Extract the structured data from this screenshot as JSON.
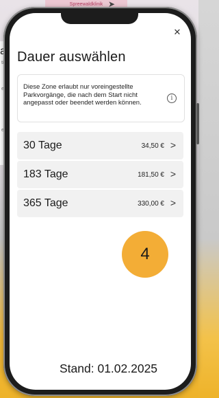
{
  "background": {
    "map_label": "Spreewaldklinik",
    "nav_icon": "navigation-arrow-icon",
    "left_fragments": [
      "a",
      "ti",
      "eit",
      "eit"
    ]
  },
  "sheet": {
    "close_icon": "close-icon",
    "title": "Dauer auswählen",
    "info": {
      "text": "Diese Zone erlaubt nur voreingestellte Parkvorgänge, die nach dem Start nicht angepasst oder beendet werden können.",
      "icon_label": "i"
    },
    "options": [
      {
        "label": "30 Tage",
        "price": "34,50 €"
      },
      {
        "label": "183 Tage",
        "price": "181,50 €"
      },
      {
        "label": "365 Tage",
        "price": "330,00 €"
      }
    ]
  },
  "annotation": {
    "step_number": "4",
    "step_color": "#f3ad36",
    "stand": "Stand: 01.02.2025"
  }
}
